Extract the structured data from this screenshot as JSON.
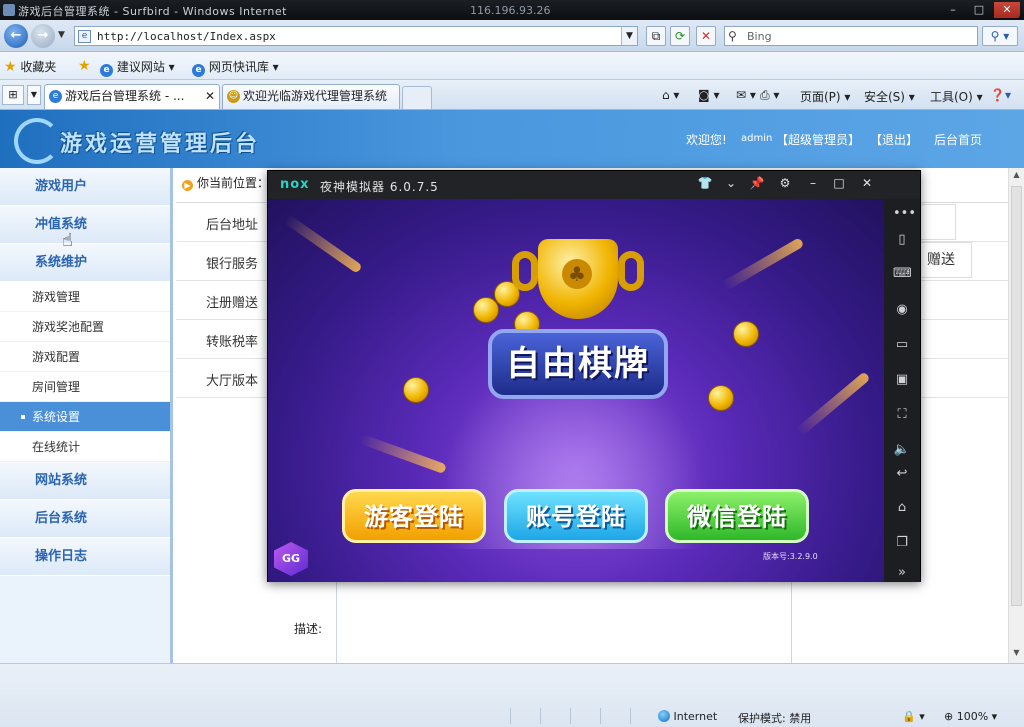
{
  "window": {
    "title": "游戏后台管理系统 - Surfbird - Windows Internet",
    "remote_ip": "116.196.93.26"
  },
  "addressbar": {
    "url": "http://localhost/Index.aspx",
    "search_placeholder": "Bing"
  },
  "favorites": {
    "label": "收藏夹",
    "items": [
      "建议网站 ▾",
      "网页快讯库 ▾"
    ]
  },
  "tabs": [
    {
      "label": "游戏后台管理系统 - ...",
      "active": true
    },
    {
      "label": "欢迎光临游戏代理管理系统",
      "active": false
    }
  ],
  "commandbar": {
    "page": "页面(P) ▾",
    "safety": "安全(S) ▾",
    "tools": "工具(O) ▾"
  },
  "site": {
    "brand": "游戏运营管理后台",
    "welcome": "欢迎您!",
    "user": "admin",
    "role": "【超级管理员】",
    "logout": "【退出】",
    "home": "后台首页"
  },
  "sidebar": {
    "groups": [
      "游戏用户",
      "冲值系统",
      "系统维护"
    ],
    "sub_items": [
      "游戏管理",
      "游戏奖池配置",
      "游戏配置",
      "房间管理",
      "系统设置",
      "在线统计"
    ],
    "selected_sub": "系统设置",
    "groups_after": [
      "网站系统",
      "后台系统",
      "操作日志"
    ]
  },
  "content": {
    "breadcrumb": "你当前位置：",
    "rows": [
      "后台地址",
      "银行服务",
      "注册赠送",
      "转账税率",
      "大厅版本"
    ],
    "right_text": "赠送",
    "desc_label": "描述:"
  },
  "emulator": {
    "logo": "nox",
    "name": "夜神模拟器 6.0.7.5",
    "game": {
      "title": "自由棋牌",
      "buttons": [
        "游客登陆",
        "账号登陆",
        "微信登陆"
      ],
      "version": "版本号:3.2.9.0",
      "gg_logo": "GG"
    }
  },
  "statusbar": {
    "zone": "Internet",
    "protected_mode": "保护模式: 禁用",
    "zoom": "100%"
  },
  "colors": {
    "header_blue": "#4a97de",
    "sidebar_bg": "#eaf2fc",
    "sidebar_selected": "#4a90d9",
    "nox_accent": "#2bd3c6"
  }
}
